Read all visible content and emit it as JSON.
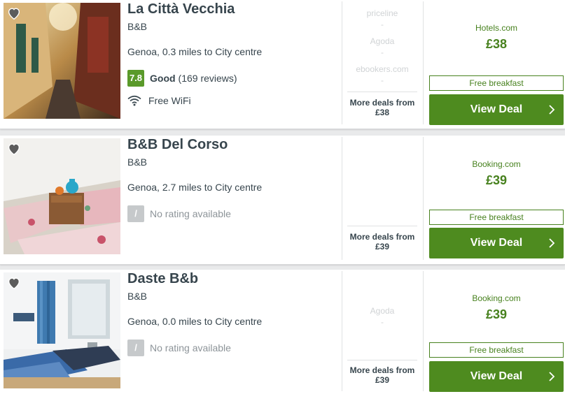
{
  "hotels": [
    {
      "name": "La Città Vecchia",
      "type": "B&B",
      "distance": "Genoa, 0.3 miles to City centre",
      "rating_score": "7.8",
      "rating_word": "Good",
      "reviews": "(169 reviews)",
      "amenity": "Free WiFi",
      "other_deals": [
        {
          "site": "priceline",
          "price": "-"
        },
        {
          "site": "Agoda",
          "price": "-"
        },
        {
          "site": "ebookers.com",
          "price": "-"
        }
      ],
      "more_deals_label": "More deals from",
      "more_deals_price": "£38",
      "provider": "Hotels.com",
      "price": "£38",
      "breakfast": "Free breakfast",
      "cta": "View Deal"
    },
    {
      "name": "B&B Del Corso",
      "type": "B&B",
      "distance": "Genoa, 2.7 miles to City centre",
      "no_rating_badge": "/",
      "no_rating_text": "No rating available",
      "more_deals_label": "More deals from",
      "more_deals_price": "£39",
      "provider": "Booking.com",
      "price": "£39",
      "breakfast": "Free breakfast",
      "cta": "View Deal"
    },
    {
      "name": "Daste B&b",
      "type": "B&B",
      "distance": "Genoa, 0.0 miles to City centre",
      "no_rating_badge": "/",
      "no_rating_text": "No rating available",
      "other_deals": [
        {
          "site": "Agoda",
          "price": "-"
        }
      ],
      "more_deals_label": "More deals from",
      "more_deals_price": "£39",
      "provider": "Booking.com",
      "price": "£39",
      "breakfast": "Free breakfast",
      "cta": "View Deal"
    }
  ],
  "colors": {
    "accent_green": "#4e8b1f",
    "rating_green": "#5a9a2a",
    "text_dark": "#37454d"
  }
}
